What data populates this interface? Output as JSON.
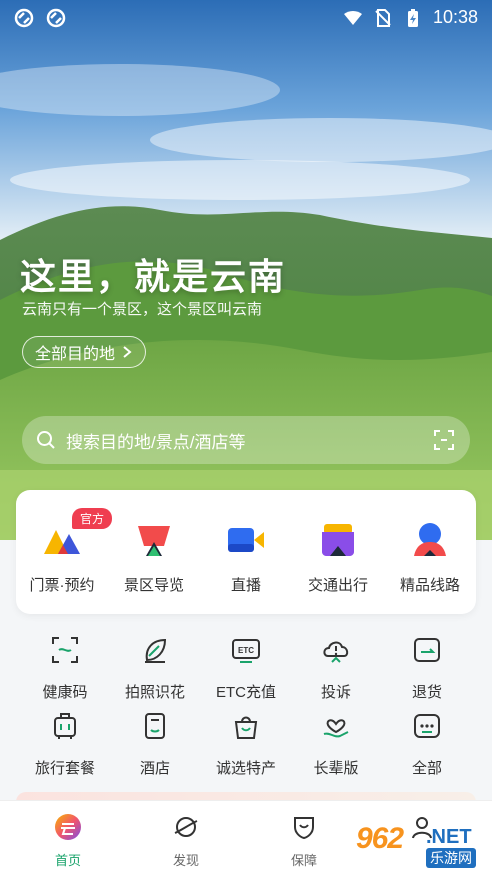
{
  "status_bar": {
    "time": "10:38"
  },
  "hero": {
    "title": "这里，就是云南",
    "subtitle": "云南只有一个景区，这个景区叫云南",
    "destinations_label": "全部目的地",
    "search_placeholder": "搜索目的地/景点/酒店等"
  },
  "featured": {
    "items": [
      {
        "label": "门票·预约",
        "icon": "ticket-icon",
        "badge": "官方"
      },
      {
        "label": "景区导览",
        "icon": "map-guide-icon"
      },
      {
        "label": "直播",
        "icon": "video-camera-icon"
      },
      {
        "label": "交通出行",
        "icon": "transport-icon"
      },
      {
        "label": "精品线路",
        "icon": "route-pin-icon"
      }
    ]
  },
  "services": {
    "row1": [
      {
        "label": "健康码",
        "icon": "scan-code-icon"
      },
      {
        "label": "拍照识花",
        "icon": "leaf-icon"
      },
      {
        "label": "ETC充值",
        "icon": "etc-card-icon"
      },
      {
        "label": "投诉",
        "icon": "complaint-cloud-icon"
      },
      {
        "label": "退货",
        "icon": "return-icon"
      }
    ],
    "row2": [
      {
        "label": "旅行套餐",
        "icon": "suitcase-icon"
      },
      {
        "label": "酒店",
        "icon": "hotel-icon"
      },
      {
        "label": "诚选特产",
        "icon": "shopping-bag-icon"
      },
      {
        "label": "长辈版",
        "icon": "elder-hands-icon"
      },
      {
        "label": "全部",
        "icon": "more-dots-icon"
      }
    ]
  },
  "tabbar": {
    "tabs": [
      {
        "label": "首页",
        "icon": "home-logo-icon",
        "active": true
      },
      {
        "label": "发现",
        "icon": "discover-planet-icon"
      },
      {
        "label": "保障",
        "icon": "shield-icon"
      }
    ]
  },
  "watermark": {
    "number": "962",
    "suffix": ".NET",
    "name": "乐游网"
  },
  "colors": {
    "accent": "#1aa36b",
    "badge": "#ef3e50",
    "watermark_orange": "#f7931e",
    "watermark_blue": "#1f6fbf"
  }
}
